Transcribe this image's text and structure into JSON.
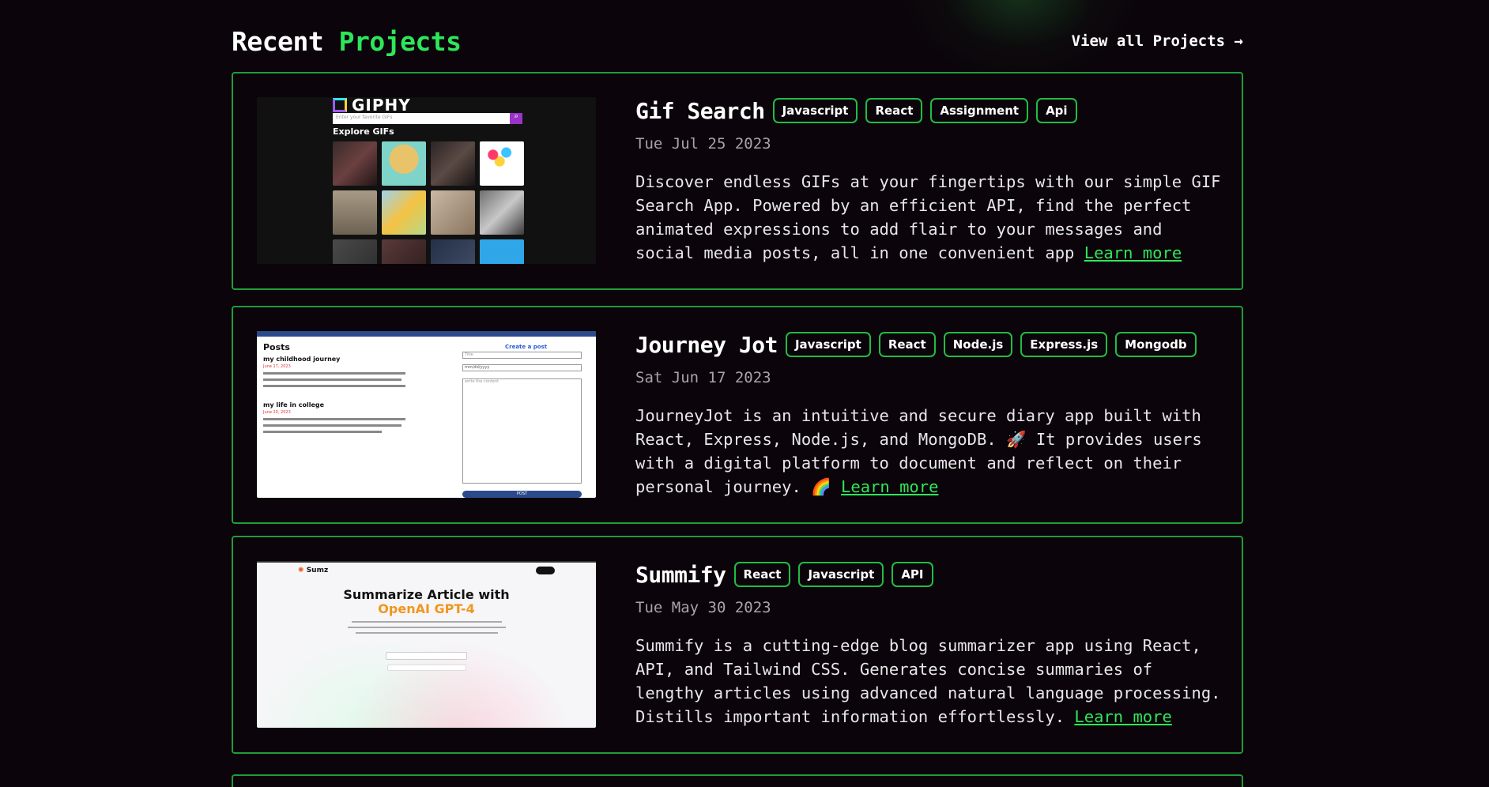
{
  "header": {
    "title_part1": "Recent",
    "title_part2": "Projects",
    "view_all": "View all Projects →"
  },
  "projects": [
    {
      "title": "Gif Search",
      "tags": [
        "Javascript",
        "React",
        "Assignment",
        "Api"
      ],
      "date": "Tue Jul 25 2023",
      "description": "Discover endless GIFs at your fingertips with our simple GIF Search App. Powered by an efficient API, find the perfect animated expressions to add flair to your messages and social media posts, all in one convenient app",
      "learn_more": "Learn more",
      "thumb": {
        "logo": "GIPHY",
        "search_placeholder": "Enter your favorite GIFs",
        "heading": "Explore GIFs"
      }
    },
    {
      "title": "Journey Jot",
      "tags": [
        "Javascript",
        "React",
        "Node.js",
        "Express.js",
        "Mongodb"
      ],
      "date": "Sat Jun 17 2023",
      "description": "JourneyJot is an intuitive and secure diary app built with React, Express, Node.js, and MongoDB. 🚀 It provides users with a digital platform to document and reflect on their personal journey. 🌈",
      "learn_more": "Learn more",
      "thumb": {
        "heading": "Posts",
        "post1_title": "my childhood journey",
        "post1_date": "June 17, 2023",
        "post2_title": "my life in college",
        "post2_date": "June 20, 2023",
        "create_label": "Create a post",
        "title_placeholder": "Title",
        "date_placeholder": "mm/dd/yyyy",
        "body_placeholder": "write the content",
        "post_button": "POST"
      }
    },
    {
      "title": "Summify",
      "tags": [
        "React",
        "Javascript",
        "API"
      ],
      "date": "Tue May 30 2023",
      "description": "Summify is a cutting-edge blog summarizer app using React, API, and Tailwind CSS. Generates concise summaries of lengthy articles using advanced natural language processing. Distills important information effortlessly.",
      "learn_more": "Learn more",
      "thumb": {
        "brand": "Sumz",
        "headline1": "Summarize Article with",
        "headline2": "OpenAI GPT-4"
      }
    }
  ],
  "colors": {
    "accent": "#2ee65a",
    "border": "#1f9c3a",
    "background": "#0b040a"
  }
}
